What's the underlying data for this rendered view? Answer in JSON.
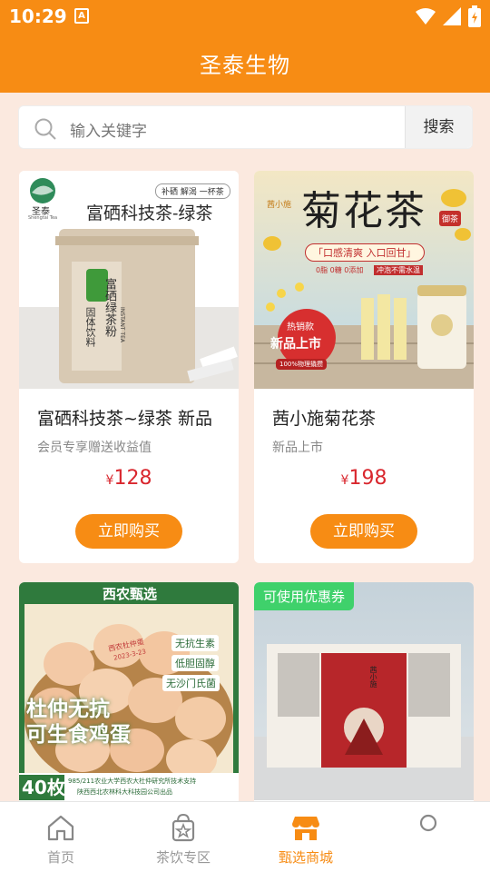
{
  "status_bar": {
    "time": "10:29",
    "notification_badge": "A"
  },
  "app_bar": {
    "title": "圣泰生物"
  },
  "search": {
    "placeholder": "输入关键字",
    "button_label": "搜索"
  },
  "products": [
    {
      "name": "富硒科技茶~绿茶  新品",
      "subtitle": "会员专享赠送收益值",
      "currency": "¥",
      "price": "128",
      "buy_label": "立即购买",
      "image": {
        "brand": "圣泰",
        "brand_en": "Shengtai Tea",
        "tag": "补硒 解渴 一杯茶",
        "headline": "富硒科技茶-绿茶",
        "jar_text": "富硒绿茶粉",
        "jar_side": "固体饮料",
        "jar_en": "INSTANT TEA"
      }
    },
    {
      "name": "茜小施菊花茶",
      "subtitle": "新品上市",
      "currency": "¥",
      "price": "198",
      "buy_label": "立即购买",
      "image": {
        "brand": "茜小施",
        "headline": "菊花茶",
        "seal": "御茶",
        "slogan": "「口感清爽 入口回甘」",
        "tags": [
          "0脂 0糖 0添加",
          "冲泡不需水温"
        ],
        "badge_top": "热销款",
        "badge_main": "新品上市",
        "badge_sub": "100%物理撬攒"
      }
    },
    {
      "image": {
        "banner": "西农甄选",
        "headline_1": "杜仲无抗",
        "headline_2": "可生食鸡蛋",
        "bullets": [
          "无抗生素",
          "低胆固醇",
          "无沙门氏菌"
        ],
        "egg_stamp": "西农杜仲蛋",
        "egg_date": "2023-3-23",
        "count": "40枚",
        "footer_1": "985/211农业大学西农大杜仲研究所技术支持",
        "footer_2": "陕西西北农林科大科技园公司出品"
      }
    },
    {
      "image": {
        "coupon_badge": "可使用优惠券",
        "box_brand": "茜小施"
      }
    }
  ],
  "bottom_nav": [
    {
      "label": "首页",
      "icon": "home-icon",
      "active": false
    },
    {
      "label": "茶饮专区",
      "icon": "tea-bag-icon",
      "active": false
    },
    {
      "label": "甄选商城",
      "icon": "store-icon",
      "active": true
    }
  ],
  "colors": {
    "primary": "#f78c14",
    "price": "#d9272e",
    "background": "#fbe9df"
  }
}
